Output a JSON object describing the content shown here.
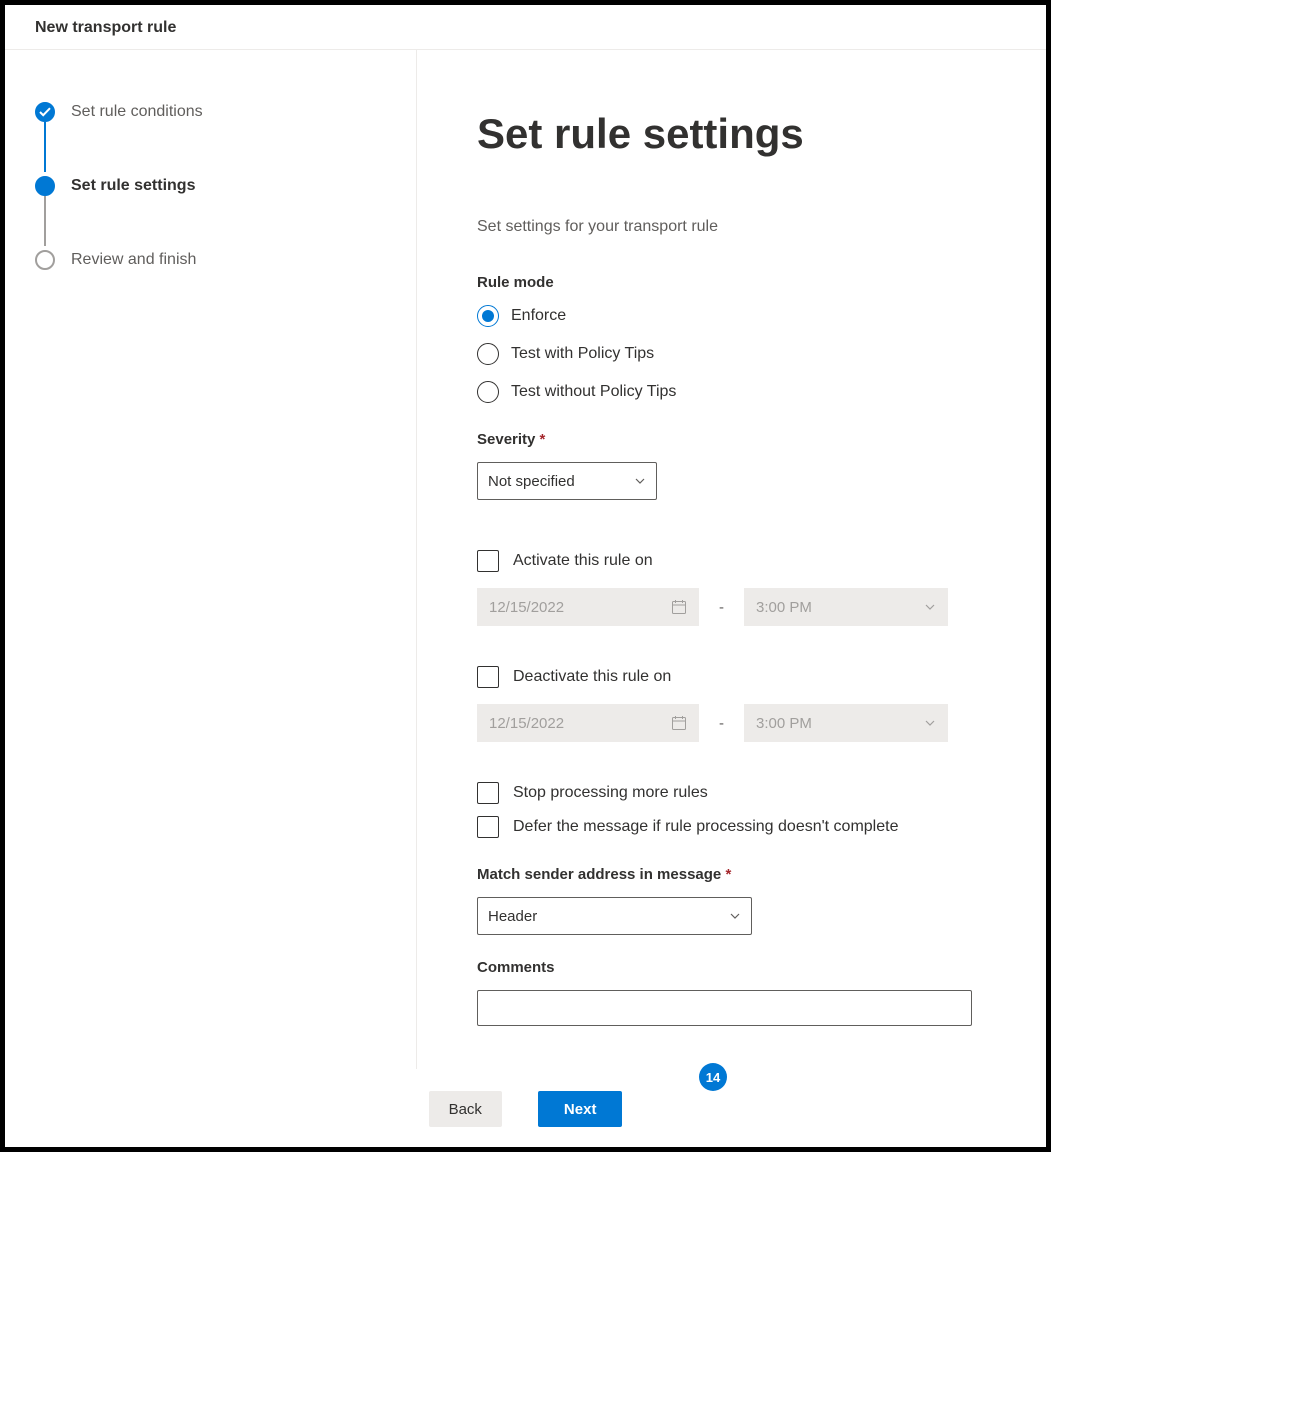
{
  "header": {
    "title": "New transport rule"
  },
  "wizard": {
    "steps": [
      {
        "label": "Set rule conditions",
        "state": "done"
      },
      {
        "label": "Set rule settings",
        "state": "current"
      },
      {
        "label": "Review and finish",
        "state": "pending"
      }
    ]
  },
  "main": {
    "title": "Set rule settings",
    "description": "Set settings for your transport rule",
    "ruleMode": {
      "label": "Rule mode",
      "options": {
        "enforce": "Enforce",
        "testWithTips": "Test with Policy Tips",
        "testWithoutTips": "Test without Policy Tips"
      },
      "selected": "enforce"
    },
    "severity": {
      "label": "Severity",
      "value": "Not specified"
    },
    "activate": {
      "label": "Activate this rule on",
      "date": "12/15/2022",
      "time": "3:00 PM",
      "separator": "-"
    },
    "deactivate": {
      "label": "Deactivate this rule on",
      "date": "12/15/2022",
      "time": "3:00 PM",
      "separator": "-"
    },
    "stopProcessing": {
      "label": "Stop processing more rules"
    },
    "deferMessage": {
      "label": "Defer the message if rule processing doesn't complete"
    },
    "matchSender": {
      "label": "Match sender address in message",
      "value": "Header"
    },
    "comments": {
      "label": "Comments"
    }
  },
  "footer": {
    "backLabel": "Back",
    "nextLabel": "Next"
  },
  "badge": {
    "value": "14"
  }
}
